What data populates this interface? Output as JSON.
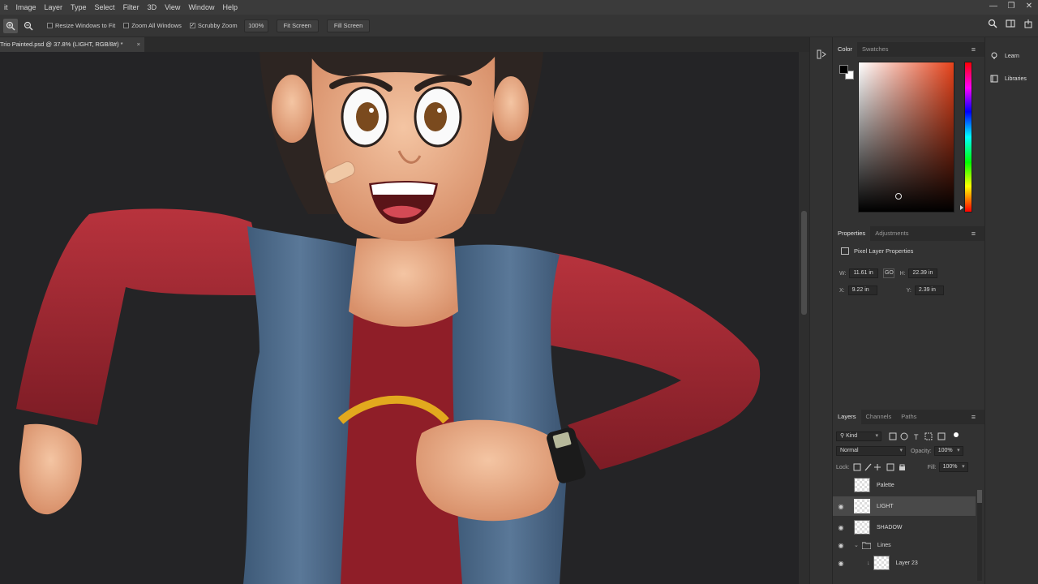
{
  "menu": [
    "it",
    "Image",
    "Layer",
    "Type",
    "Select",
    "Filter",
    "3D",
    "View",
    "Window",
    "Help"
  ],
  "window_controls": [
    "—",
    "❐",
    "✕"
  ],
  "options": {
    "resize_windows": "Resize Windows to Fit",
    "zoom_all": "Zoom All Windows",
    "scrubby_zoom": "Scrubby Zoom",
    "scrubby_check": "✓",
    "zoom_pct": "100%",
    "fit_screen": "Fit Screen",
    "fill_screen": "Fill Screen"
  },
  "document": {
    "tab_title": "Trio Painted.psd @ 37.8% (LIGHT, RGB/8#) *",
    "close": "×"
  },
  "color_panel": {
    "tabs": [
      "Color",
      "Swatches"
    ],
    "menu": "≡",
    "foreground": "#000000",
    "background": "#ffffff",
    "hue_base": "#e6421a"
  },
  "properties_panel": {
    "tabs": [
      "Properties",
      "Adjustments"
    ],
    "menu": "≡",
    "title": "Pixel Layer Properties",
    "w_label": "W:",
    "w_value": "11.61 in",
    "h_label": "H:",
    "h_value": "22.39 in",
    "x_label": "X:",
    "x_value": "9.22 in",
    "y_label": "Y:",
    "y_value": "2.39 in",
    "link": "GO"
  },
  "layers_panel": {
    "tabs": [
      "Layers",
      "Channels",
      "Paths"
    ],
    "menu": "≡",
    "filter_label": "Kind",
    "blend_mode": "Normal",
    "opacity_label": "Opacity:",
    "opacity_value": "100%",
    "lock_label": "Lock:",
    "fill_label": "Fill:",
    "fill_value": "100%",
    "layers": [
      {
        "name": "Palette",
        "visible": false
      },
      {
        "name": "LIGHT",
        "visible": true
      },
      {
        "name": "SHADOW",
        "visible": true
      },
      {
        "name": "Lines",
        "visible": true
      },
      {
        "name": "Layer 23",
        "visible": true
      }
    ]
  },
  "dock": {
    "learn": "Learn",
    "libraries": "Libraries"
  }
}
